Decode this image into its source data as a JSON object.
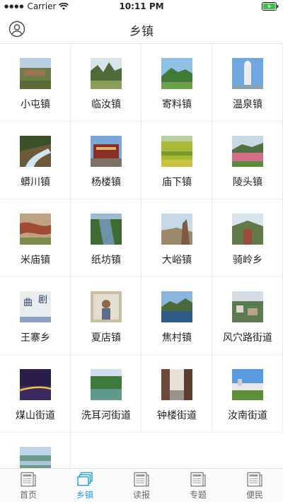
{
  "status_bar": {
    "carrier": "Carrier",
    "time": "10:11 PM"
  },
  "header": {
    "title": "乡镇"
  },
  "towns": [
    {
      "label": "小屯镇"
    },
    {
      "label": "临汝镇"
    },
    {
      "label": "寄料镇"
    },
    {
      "label": "温泉镇"
    },
    {
      "label": "蟒川镇"
    },
    {
      "label": "杨楼镇"
    },
    {
      "label": "庙下镇"
    },
    {
      "label": "陵头镇"
    },
    {
      "label": "米庙镇"
    },
    {
      "label": "纸坊镇"
    },
    {
      "label": "大峪镇"
    },
    {
      "label": "骑岭乡"
    },
    {
      "label": "王寨乡"
    },
    {
      "label": "夏店镇"
    },
    {
      "label": "焦村镇"
    },
    {
      "label": "风穴路街道"
    },
    {
      "label": "煤山街道"
    },
    {
      "label": "洗耳河街道"
    },
    {
      "label": "钟楼街道"
    },
    {
      "label": "汝南街道"
    },
    {
      "label": ""
    }
  ],
  "thumb_text": {
    "wangzhai_left": "曲",
    "wangzhai_right": "剧"
  },
  "tabs": [
    {
      "label": "首页",
      "icon": "newspaper-icon"
    },
    {
      "label": "乡镇",
      "icon": "stacked-pages-icon"
    },
    {
      "label": "读报",
      "icon": "newspaper-icon"
    },
    {
      "label": "专题",
      "icon": "newspaper-icon"
    },
    {
      "label": "便民",
      "icon": "newspaper-icon"
    }
  ],
  "colors": {
    "accent": "#1a9be0",
    "tab_inactive": "#666666",
    "divider": "#ececec"
  }
}
